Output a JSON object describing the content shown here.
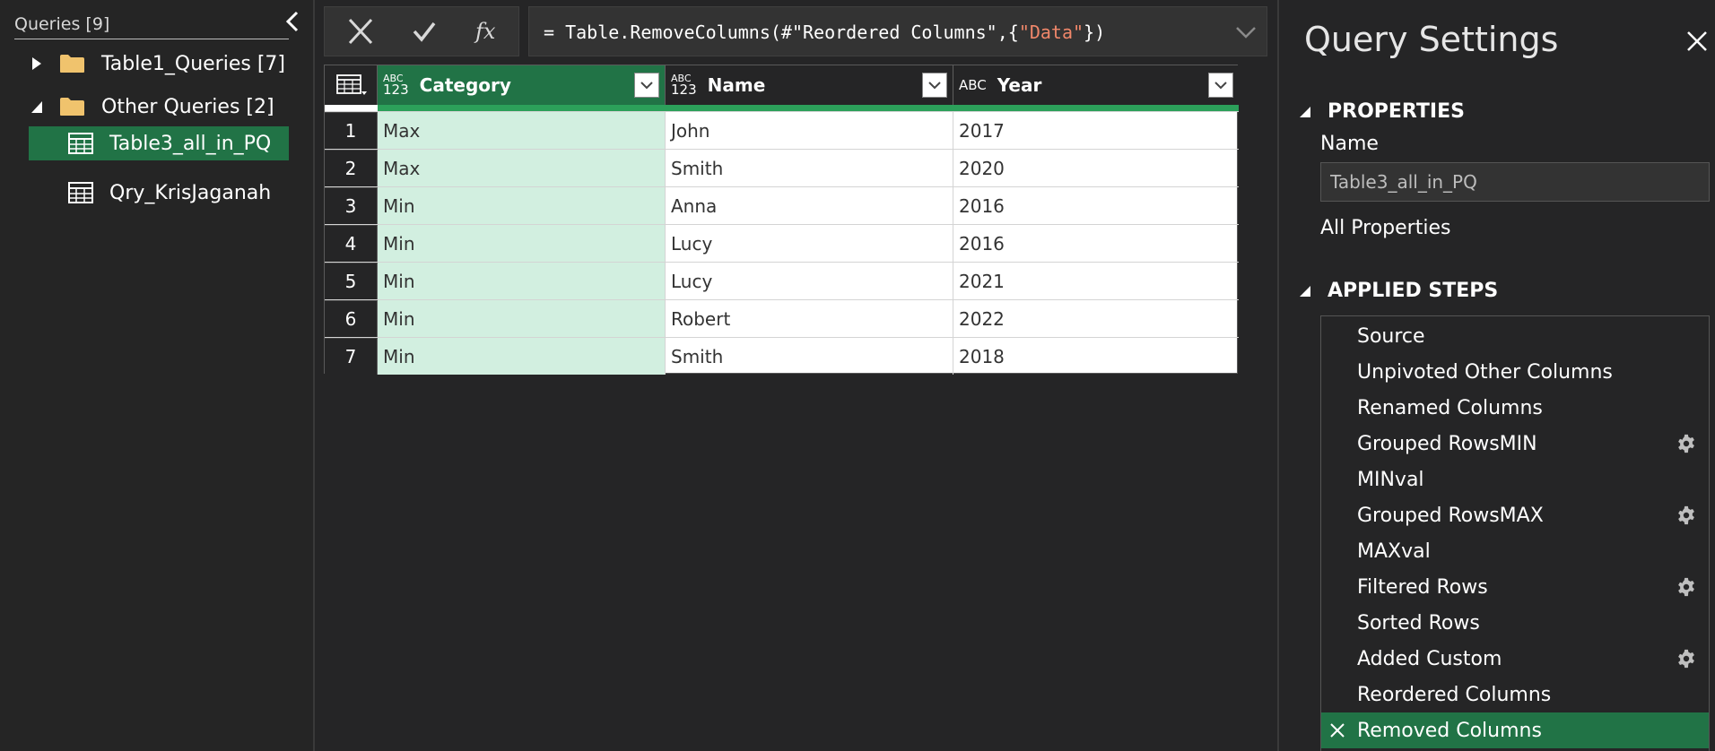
{
  "navigator": {
    "title": "Queries [9]",
    "groups": [
      {
        "label": "Table1_Queries [7]",
        "expanded": false
      },
      {
        "label": "Other Queries [2]",
        "expanded": true
      }
    ],
    "queries": [
      {
        "label": "Table3_all_in_PQ",
        "selected": true
      },
      {
        "label": "Qry_KrisJaganah",
        "selected": false
      }
    ]
  },
  "formula_bar": {
    "prefix": "= Table.RemoveColumns(#\"Reordered Columns\",{",
    "string_arg": "\"Data\"",
    "suffix": "})"
  },
  "grid": {
    "columns": [
      {
        "name": "Category",
        "type_top": "ABC",
        "type_bottom": "123",
        "selected": true
      },
      {
        "name": "Name",
        "type_top": "ABC",
        "type_bottom": "123",
        "selected": false
      },
      {
        "name": "Year",
        "type_top": "ABC",
        "type_bottom": "",
        "selected": false
      }
    ],
    "rows": [
      [
        "1",
        "Max",
        "John",
        "2017"
      ],
      [
        "2",
        "Max",
        "Smith",
        "2020"
      ],
      [
        "3",
        "Min",
        "Anna",
        "2016"
      ],
      [
        "4",
        "Min",
        "Lucy",
        "2016"
      ],
      [
        "5",
        "Min",
        "Lucy",
        "2021"
      ],
      [
        "6",
        "Min",
        "Robert",
        "2022"
      ],
      [
        "7",
        "Min",
        "Smith",
        "2018"
      ]
    ]
  },
  "settings": {
    "title": "Query Settings",
    "properties_header": "PROPERTIES",
    "name_label": "Name",
    "name_value": "Table3_all_in_PQ",
    "all_properties": "All Properties",
    "steps_header": "APPLIED STEPS",
    "steps": [
      {
        "label": "Source",
        "gear": false,
        "active": false
      },
      {
        "label": "Unpivoted Other Columns",
        "gear": false,
        "active": false
      },
      {
        "label": "Renamed Columns",
        "gear": false,
        "active": false
      },
      {
        "label": "Grouped RowsMIN",
        "gear": true,
        "active": false
      },
      {
        "label": "MINval",
        "gear": false,
        "active": false
      },
      {
        "label": "Grouped RowsMAX",
        "gear": true,
        "active": false
      },
      {
        "label": "MAXval",
        "gear": false,
        "active": false
      },
      {
        "label": "Filtered Rows",
        "gear": true,
        "active": false
      },
      {
        "label": "Sorted Rows",
        "gear": false,
        "active": false
      },
      {
        "label": "Added Custom",
        "gear": true,
        "active": false
      },
      {
        "label": "Reordered Columns",
        "gear": false,
        "active": false
      },
      {
        "label": "Removed Columns",
        "gear": false,
        "active": true
      }
    ]
  },
  "colors": {
    "accent": "#217346",
    "selected_column_bg": "#d2efe0",
    "quality_bar": "#2ca05a",
    "formula_string": "#f0876a"
  }
}
